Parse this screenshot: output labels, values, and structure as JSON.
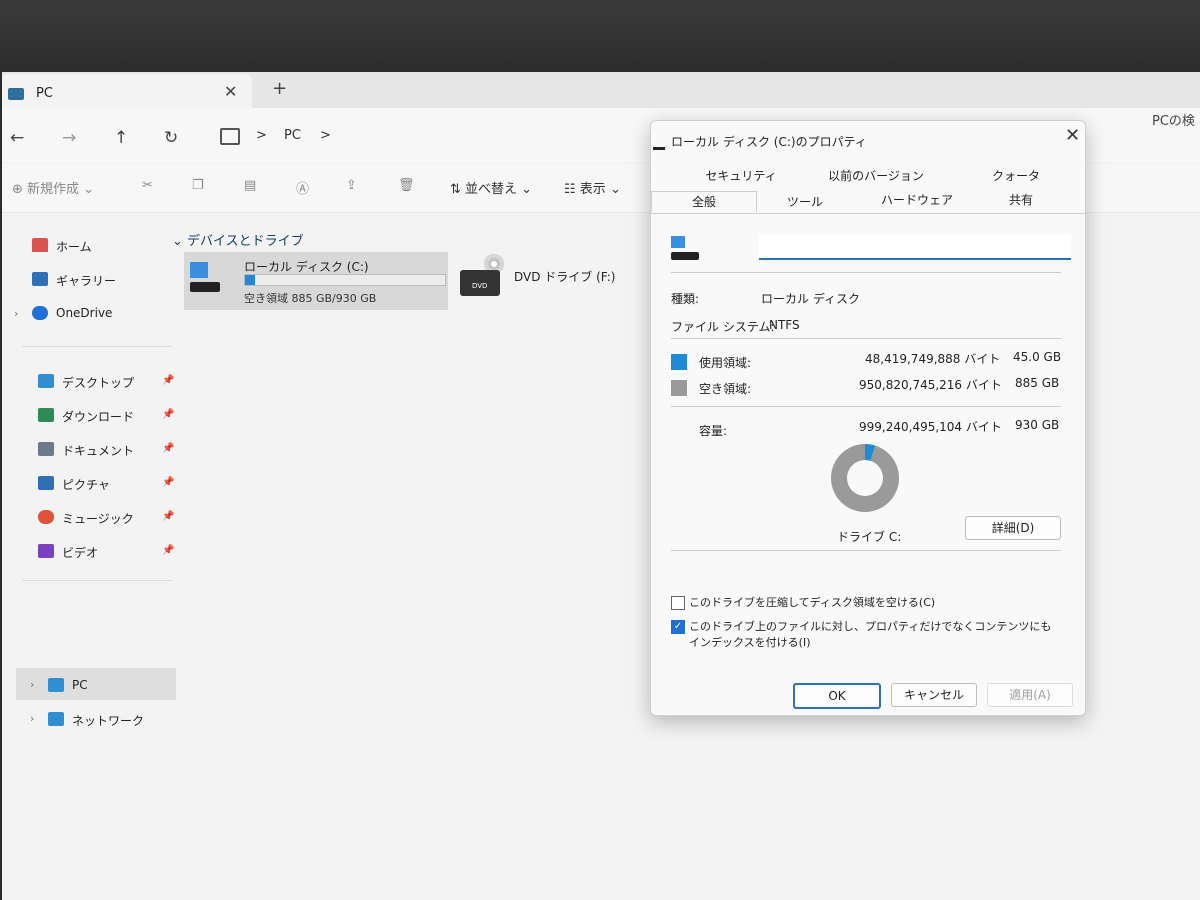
{
  "tab": {
    "title": "PC",
    "close": "✕",
    "new": "+"
  },
  "nav": {
    "back": "←",
    "forward": "→",
    "up": "↑",
    "refresh": "↻",
    "sep": ">",
    "location": "PC",
    "sep2": ">",
    "search_partial": "PCの検"
  },
  "toolbar": {
    "new_label": "新規作成",
    "sort_label": "並べ替え",
    "view_label": "表示"
  },
  "sidebar": {
    "home": "ホーム",
    "gallery": "ギャラリー",
    "onedrive": "OneDrive",
    "desktop": "デスクトップ",
    "downloads": "ダウンロード",
    "documents": "ドキュメント",
    "pictures": "ピクチャ",
    "music": "ミュージック",
    "videos": "ビデオ",
    "pc": "PC",
    "network": "ネットワーク"
  },
  "content": {
    "group_title": "デバイスとドライブ",
    "drive_c": {
      "name": "ローカル ディスク (C:)",
      "free_text": "空き領域 885 GB/930 GB",
      "used_fraction": 0.048
    },
    "drive_f": {
      "name": "DVD ドライブ (F:)",
      "icon_text": "DVD"
    }
  },
  "dialog": {
    "title": "ローカル ディスク (C:)のプロパティ",
    "tabs_row1": [
      "セキュリティ",
      "以前のバージョン",
      "クォータ"
    ],
    "tabs_row2": [
      "全般",
      "ツール",
      "ハードウェア",
      "共有"
    ],
    "name_value": "",
    "type_label": "種類:",
    "type_value": "ローカル ディスク",
    "fs_label": "ファイル システム:",
    "fs_value": "NTFS",
    "used_label": "使用領域:",
    "used_bytes": "48,419,749,888 バイト",
    "used_gb": "45.0 GB",
    "free_label": "空き領域:",
    "free_bytes": "950,820,745,216 バイト",
    "free_gb": "885 GB",
    "cap_label": "容量:",
    "cap_bytes": "999,240,495,104 バイト",
    "cap_gb": "930 GB",
    "drive_label": "ドライブ C:",
    "details_btn": "詳細(D)",
    "compress_label": "このドライブを圧縮してディスク領域を空ける(C)",
    "index_label": "このドライブ上のファイルに対し、プロパティだけでなくコンテンツにもインデックスを付ける(I)",
    "ok": "OK",
    "cancel": "キャンセル",
    "apply": "適用(A)",
    "used_color": "#1f8ad6",
    "free_color": "#9a9a9a"
  }
}
